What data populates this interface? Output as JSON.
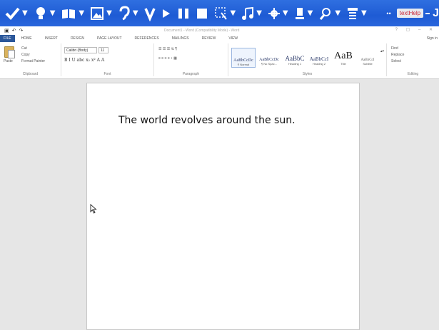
{
  "overlay": {
    "icons": [
      "checkmark-icon",
      "bulb-icon",
      "book-icon",
      "image-icon",
      "ear-icon",
      "v-letter-icon",
      "play-icon",
      "pause-icon",
      "stop-icon",
      "selection-icon",
      "music-note-icon",
      "gear-icon",
      "flask-icon",
      "puzzle-icon",
      "hanger-icon"
    ],
    "caret": "▼",
    "dots": "••",
    "user_badge": "textHelp",
    "right_letter": "J"
  },
  "window": {
    "title": "Document1 - Word (Compatibility Mode) - Word",
    "controls": "? ▢ – ✕"
  },
  "tabs": [
    "FILE",
    "HOME",
    "INSERT",
    "DESIGN",
    "PAGE LAYOUT",
    "REFERENCES",
    "MAILINGS",
    "REVIEW",
    "VIEW"
  ],
  "signin": "Sign in",
  "ribbon": {
    "clipboard": {
      "label": "Clipboard",
      "paste": "Paste",
      "cut": "Cut",
      "copy": "Copy",
      "format_painter": "Format Painter"
    },
    "font": {
      "label": "Font",
      "name": "Calibri (Body)",
      "size": "11",
      "row": "B  I  U  abc  x₂  x²  A  A"
    },
    "paragraph": {
      "label": "Paragraph"
    },
    "styles": {
      "label": "Styles",
      "items": [
        {
          "preview": "AaBbCcDc",
          "name": "¶ Normal"
        },
        {
          "preview": "AaBbCcDc",
          "name": "¶ No Spac..."
        },
        {
          "preview": "AaBbC",
          "name": "Heading 1"
        },
        {
          "preview": "AaBbCcI",
          "name": "Heading 2"
        },
        {
          "preview": "AaB",
          "name": "Title"
        },
        {
          "preview": "AaBbCcI",
          "name": "Subtitle"
        }
      ]
    },
    "editing": {
      "label": "Editing",
      "find": "Find",
      "replace": "Replace",
      "select": "Select"
    }
  },
  "document": {
    "text": "The world revolves around the sun."
  }
}
